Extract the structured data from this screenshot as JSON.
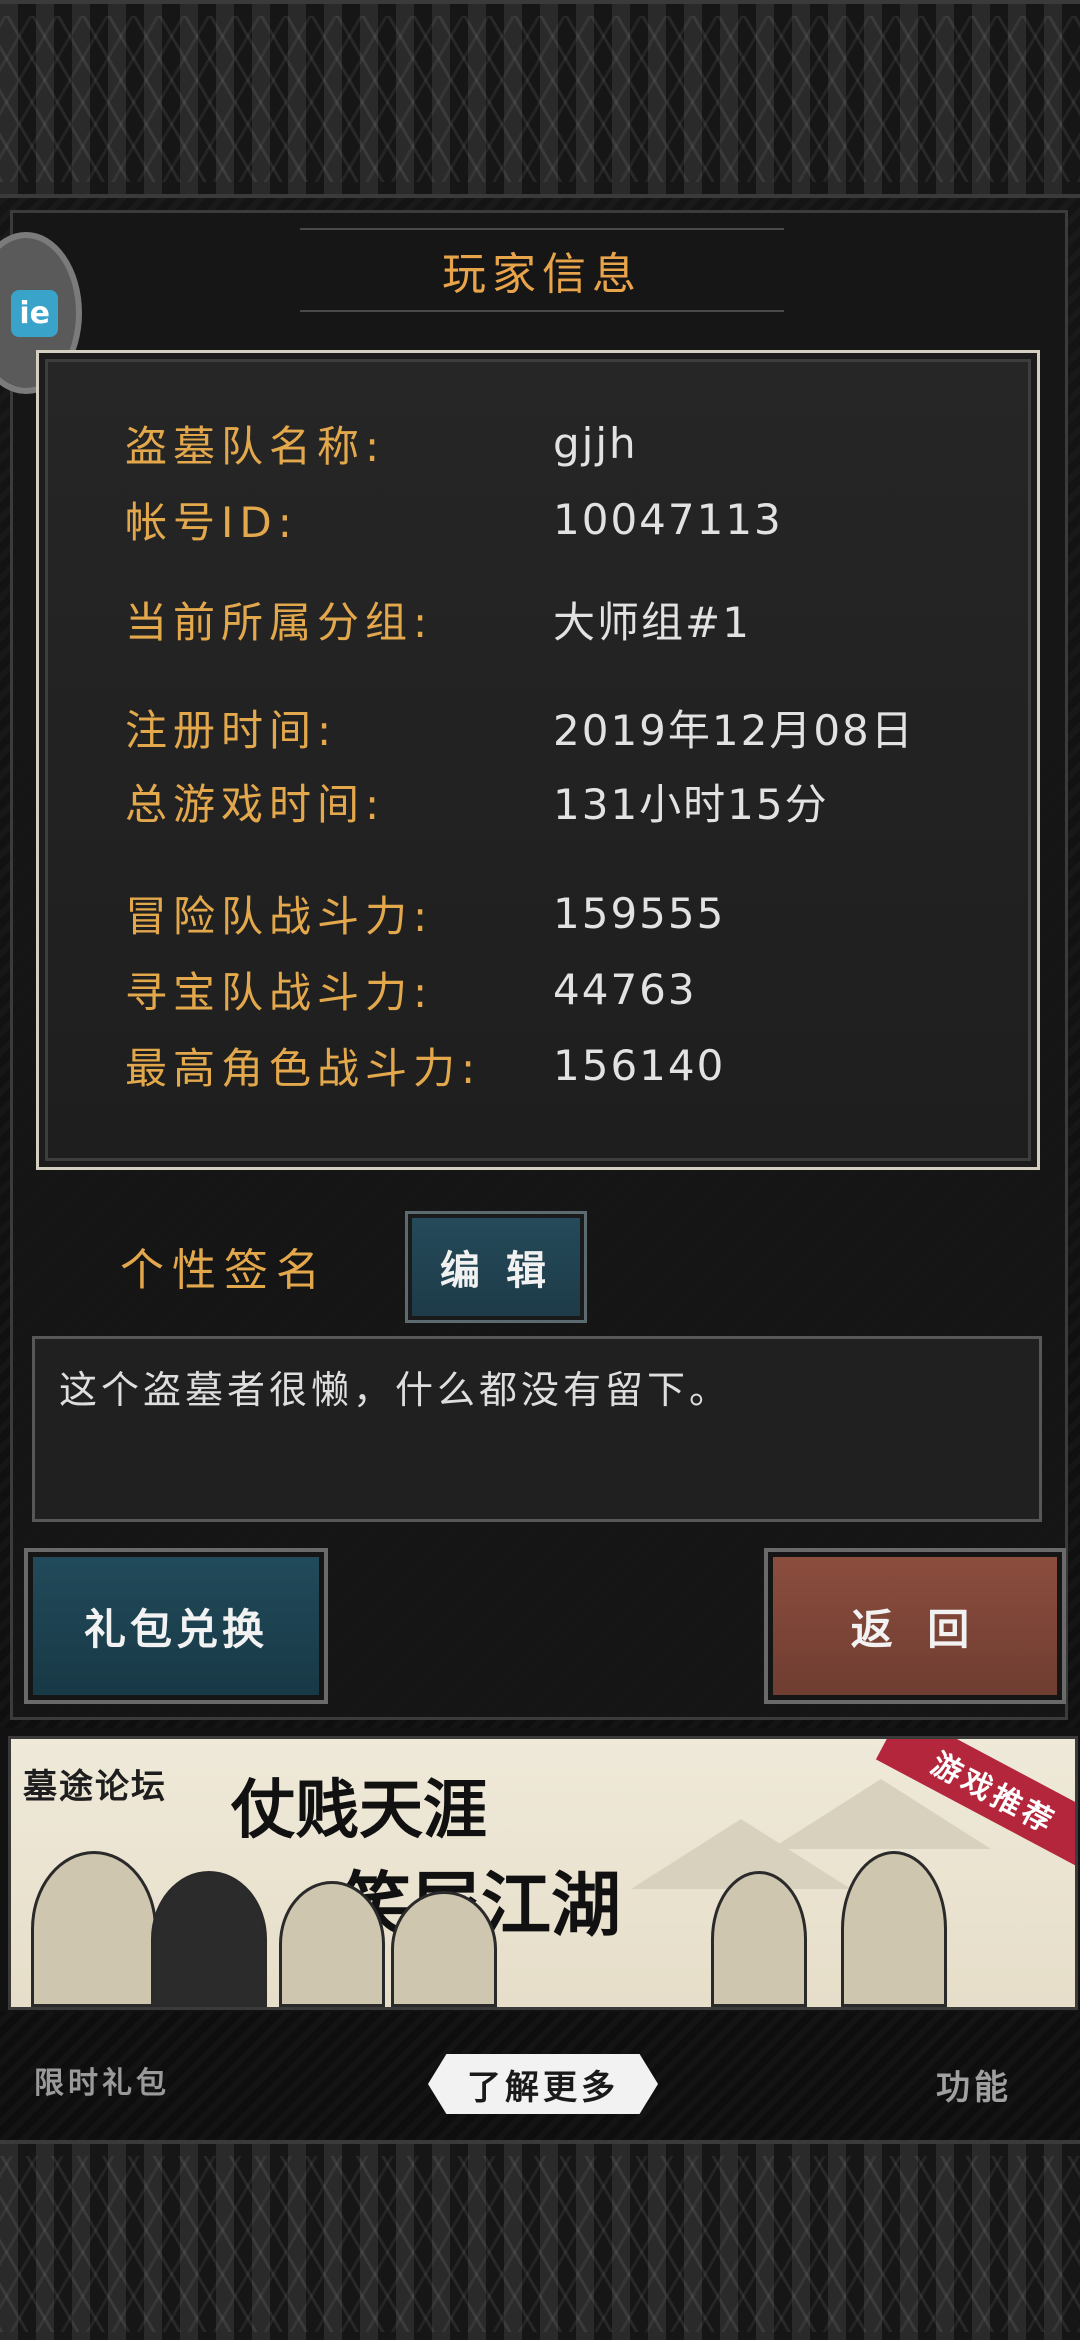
{
  "header": {
    "title": "玩家信息"
  },
  "floating_widget": {
    "badge": "ie"
  },
  "info": {
    "team_name": {
      "label": "盗墓队名称:",
      "value": "gjjh"
    },
    "account_id": {
      "label": "帐号ID:",
      "value": "10047113"
    },
    "group": {
      "label": "当前所属分组:",
      "value": "大师组#1"
    },
    "register_time": {
      "label": "注册时间:",
      "value": "2019年12月08日"
    },
    "total_play_time": {
      "label": "总游戏时间:",
      "value": "131小时15分"
    },
    "adventure_power": {
      "label": "冒险队战斗力:",
      "value": "159555"
    },
    "treasure_power": {
      "label": "寻宝队战斗力:",
      "value": "44763"
    },
    "top_character_power": {
      "label": "最高角色战斗力:",
      "value": "156140"
    }
  },
  "signature": {
    "label": "个性签名",
    "edit_button": "编 辑",
    "text": "这个盗墓者很懒，什么都没有留下。"
  },
  "actions": {
    "gift_redeem": "礼包兑换",
    "back": "返 回"
  },
  "ad": {
    "logo": "墓途论坛",
    "line1": "仗贱天涯",
    "line2": "笑尿江湖",
    "ribbon": "游戏推荐",
    "learn_more": "了解更多"
  },
  "bottom_nav": {
    "left": "限时礼包",
    "right": "功能"
  }
}
